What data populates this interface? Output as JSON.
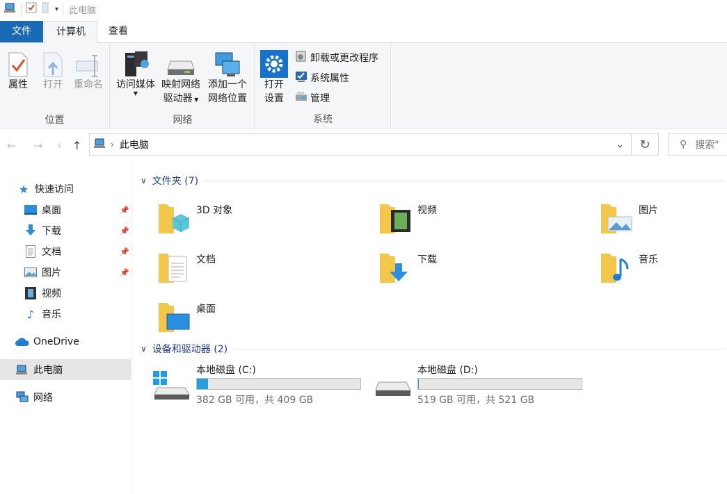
{
  "window": {
    "title": "此电脑"
  },
  "ribbon_tabs": [
    "文件",
    "计算机",
    "查看"
  ],
  "ribbon": {
    "location_group": {
      "label": "位置",
      "properties": "属性",
      "open": "打开",
      "rename": "重命名"
    },
    "network_group": {
      "label": "网络",
      "access_media": "访问媒体",
      "map_drive_1": "映射网络",
      "map_drive_2": "驱动器",
      "add_location_1": "添加一个",
      "add_location_2": "网络位置"
    },
    "system_group": {
      "label": "系统",
      "open_settings_1": "打开",
      "open_settings_2": "设置",
      "uninstall": "卸载或更改程序",
      "system_properties": "系统属性",
      "manage": "管理"
    }
  },
  "address": {
    "path": "此电脑",
    "search_placeholder": "搜索\""
  },
  "sidebar": {
    "quick_access": "快速访问",
    "pinned": [
      "桌面",
      "下载",
      "文档",
      "图片"
    ],
    "unpinned": [
      "视频",
      "音乐"
    ],
    "onedrive": "OneDrive",
    "this_pc": "此电脑",
    "network": "网络"
  },
  "folders_section": {
    "title": "文件夹 (7)"
  },
  "folders": [
    "3D 对象",
    "视频",
    "图片",
    "文档",
    "下载",
    "音乐",
    "桌面"
  ],
  "drives_section": {
    "title": "设备和驱动器 (2)"
  },
  "drives": [
    {
      "name": "本地磁盘 (C:)",
      "info": "382 GB 可用，共 409 GB",
      "used_fraction": 0.066
    },
    {
      "name": "本地磁盘 (D:)",
      "info": "519 GB 可用，共 521 GB",
      "used_fraction": 0.004
    }
  ],
  "colors": {
    "accent": "#1a6ab3",
    "drive_fill": "#26a0da",
    "folder_yellow": "#f3c74a"
  }
}
